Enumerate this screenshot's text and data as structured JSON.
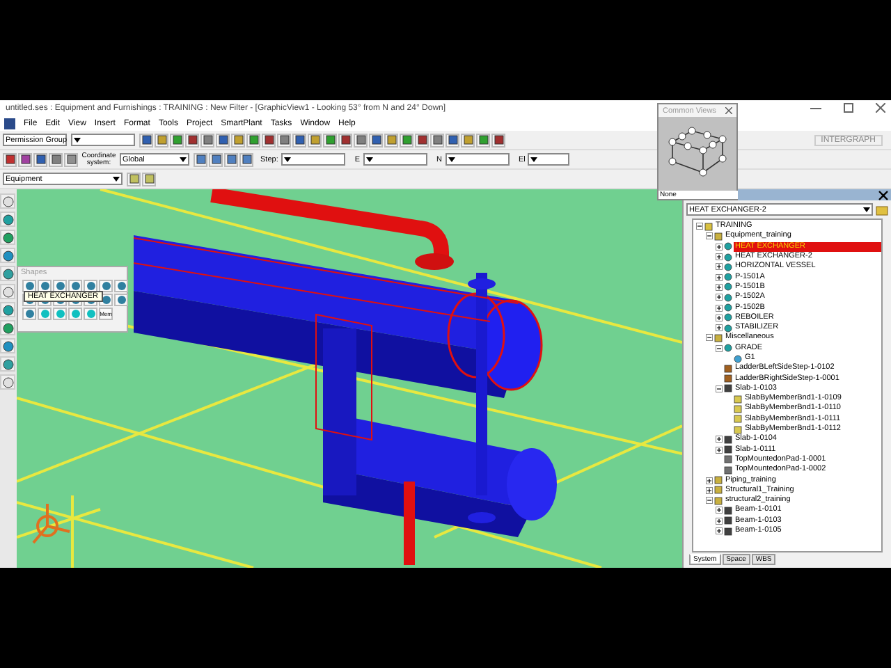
{
  "window": {
    "title": "untitled.ses : Equipment and Furnishings : TRAINING : New Filter - [GraphicView1 - Looking 53° from N and 24° Down]"
  },
  "menu": [
    "File",
    "Edit",
    "View",
    "Insert",
    "Format",
    "Tools",
    "Project",
    "SmartPlant",
    "Tasks",
    "Window",
    "Help"
  ],
  "toolbar": {
    "permission_group": "Permission Group",
    "coordinate_label": "Coordinate system:",
    "coordinate_value": "Global",
    "step_label": "Step:",
    "e_label": "E",
    "n_label": "N",
    "el_label": "El",
    "locate_filter": "Equipment",
    "logo": "INTERGRAPH"
  },
  "common_views": {
    "title": "Common Views",
    "footer": "None"
  },
  "shapes": {
    "title": "Shapes",
    "tooltip": "HEAT EXCHANGER",
    "more_label": "Mem"
  },
  "explorer": {
    "selector": "HEAT EXCHANGER-2",
    "tree": [
      {
        "label": "TRAINING",
        "kind": "root",
        "expanded": true,
        "selected": false,
        "children": [
          {
            "label": "Equipment_training",
            "kind": "system",
            "expanded": true,
            "selected": false,
            "children": [
              {
                "label": "HEAT EXCHANGER",
                "kind": "equipment",
                "expanded": false,
                "selected": true
              },
              {
                "label": "HEAT EXCHANGER-2",
                "kind": "equipment",
                "expanded": false,
                "selected": false
              },
              {
                "label": "HORIZONTAL VESSEL",
                "kind": "equipment",
                "expanded": false,
                "selected": false
              },
              {
                "label": "P-1501A",
                "kind": "equipment",
                "expanded": false,
                "selected": false
              },
              {
                "label": "P-1501B",
                "kind": "equipment",
                "expanded": false,
                "selected": false
              },
              {
                "label": "P-1502A",
                "kind": "equipment",
                "expanded": false,
                "selected": false
              },
              {
                "label": "P-1502B",
                "kind": "equipment",
                "expanded": false,
                "selected": false
              },
              {
                "label": "REBOILER",
                "kind": "equipment",
                "expanded": false,
                "selected": false
              },
              {
                "label": "STABILIZER",
                "kind": "equipment",
                "expanded": false,
                "selected": false
              }
            ]
          },
          {
            "label": "Miscellaneous",
            "kind": "system",
            "expanded": true,
            "selected": false,
            "children": [
              {
                "label": "GRADE",
                "kind": "equipment",
                "expanded": true,
                "selected": false,
                "children": [
                  {
                    "label": "G1",
                    "kind": "part",
                    "selected": false
                  }
                ]
              },
              {
                "label": "LadderBLeftSideStep-1-0102",
                "kind": "ladder",
                "selected": false
              },
              {
                "label": "LadderBRightSideStep-1-0001",
                "kind": "ladder",
                "selected": false
              },
              {
                "label": "Slab-1-0103",
                "kind": "slab",
                "expanded": true,
                "selected": false,
                "children": [
                  {
                    "label": "SlabByMemberBnd1-1-0109",
                    "kind": "folder",
                    "selected": false
                  },
                  {
                    "label": "SlabByMemberBnd1-1-0110",
                    "kind": "folder",
                    "selected": false
                  },
                  {
                    "label": "SlabByMemberBnd1-1-0111",
                    "kind": "folder",
                    "selected": false
                  },
                  {
                    "label": "SlabByMemberBnd1-1-0112",
                    "kind": "folder",
                    "selected": false
                  }
                ]
              },
              {
                "label": "Slab-1-0104",
                "kind": "slab",
                "expanded": false,
                "selected": false
              },
              {
                "label": "Slab-1-0111",
                "kind": "slab",
                "expanded": false,
                "selected": false
              },
              {
                "label": "TopMountedonPad-1-0001",
                "kind": "pad",
                "selected": false
              },
              {
                "label": "TopMountedonPad-1-0002",
                "kind": "pad",
                "selected": false
              }
            ]
          },
          {
            "label": "Piping_training",
            "kind": "system",
            "expanded": false,
            "selected": false
          },
          {
            "label": "Structural1_Training",
            "kind": "system",
            "expanded": false,
            "selected": false
          },
          {
            "label": "structural2_training",
            "kind": "system",
            "expanded": true,
            "selected": false,
            "children": [
              {
                "label": "Beam-1-0101",
                "kind": "beam",
                "expanded": false,
                "selected": false
              },
              {
                "label": "Beam-1-0103",
                "kind": "beam",
                "expanded": false,
                "selected": false
              },
              {
                "label": "Beam-1-0105",
                "kind": "beam",
                "expanded": false,
                "selected": false
              }
            ]
          }
        ]
      }
    ],
    "tabs": [
      {
        "label": "System",
        "selected": true
      },
      {
        "label": "Space",
        "selected": false
      },
      {
        "label": "WBS",
        "selected": false
      }
    ]
  }
}
